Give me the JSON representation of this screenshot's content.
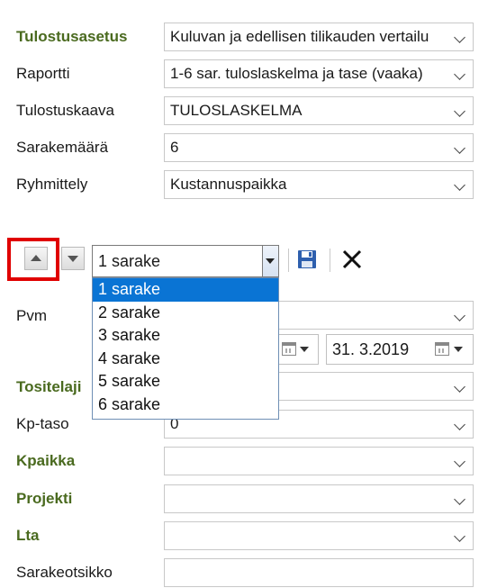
{
  "settings": {
    "print_setting": {
      "label": "Tulostusasetus",
      "value": "Kuluvan ja edellisen tilikauden vertailu"
    },
    "report": {
      "label": "Raportti",
      "value": "1-6 sar. tuloslaskelma ja tase (vaaka)"
    },
    "print_template": {
      "label": "Tulostuskaava",
      "value": "TULOSLASKELMA"
    },
    "column_count": {
      "label": "Sarakemäärä",
      "value": "6"
    },
    "grouping": {
      "label": "Ryhmittely",
      "value": "Kustannuspaikka"
    }
  },
  "toolbar": {
    "column_select": {
      "value": "1 sarake"
    }
  },
  "column_dropdown": {
    "options": [
      "1 sarake",
      "2 sarake",
      "3 sarake",
      "4 sarake",
      "5 sarake",
      "6 sarake"
    ],
    "selected_index": 0
  },
  "column_form": {
    "date": {
      "label": "Pvm",
      "value": ""
    },
    "date_end": {
      "value": "31.  3.2019"
    },
    "voucher_type": {
      "label": "Tositelaji",
      "value": ""
    },
    "cost_center_level": {
      "label": "Kp-taso",
      "value": "0"
    },
    "cost_center": {
      "label": "Kpaikka",
      "value": ""
    },
    "project": {
      "label": "Projekti",
      "value": ""
    },
    "lta": {
      "label": "Lta",
      "value": ""
    },
    "column_header": {
      "label": "Sarakeotsikko",
      "value": ""
    }
  },
  "colors": {
    "bold_label": "#4a6a1f",
    "highlight_border": "#e00000",
    "selection": "#0a74d4"
  }
}
